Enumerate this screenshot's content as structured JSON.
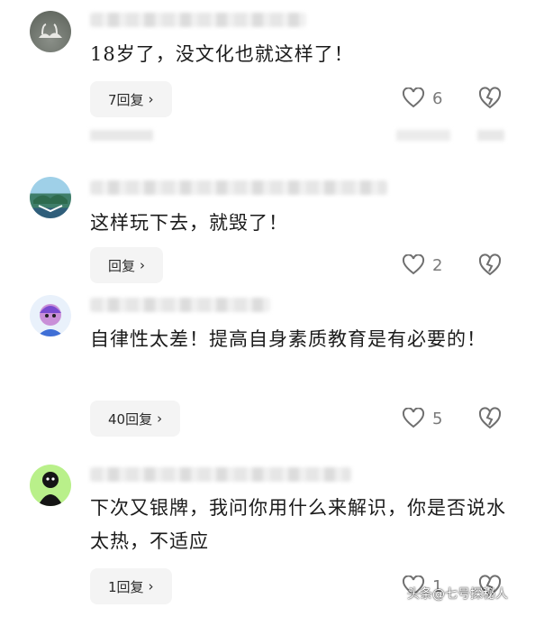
{
  "comments": [
    {
      "text": "18岁了，没文化也就这样了！",
      "reply_label": "7回复",
      "likes": "6"
    },
    {
      "text": "这样玩下去，就毁了！",
      "reply_label": "回复",
      "likes": "2"
    },
    {
      "text": "自律性太差！提高自身素质教育是有必要的！",
      "reply_label": "40回复",
      "likes": "5"
    },
    {
      "text": "下次又银牌，我问你用什么来解识，你是否说水太热，不适应",
      "reply_label": "1回复",
      "likes": "1"
    }
  ],
  "icons": {
    "like": "heart-outline-icon",
    "dislike": "broken-heart-icon",
    "chevron": "chevron-right-icon"
  },
  "chevron_glyph": "›",
  "watermark": "头条@七号探秘人",
  "colors": {
    "reply_bg": "#f4f4f4",
    "icon_stroke": "#6f6f6f",
    "count": "#7a7a7a"
  }
}
